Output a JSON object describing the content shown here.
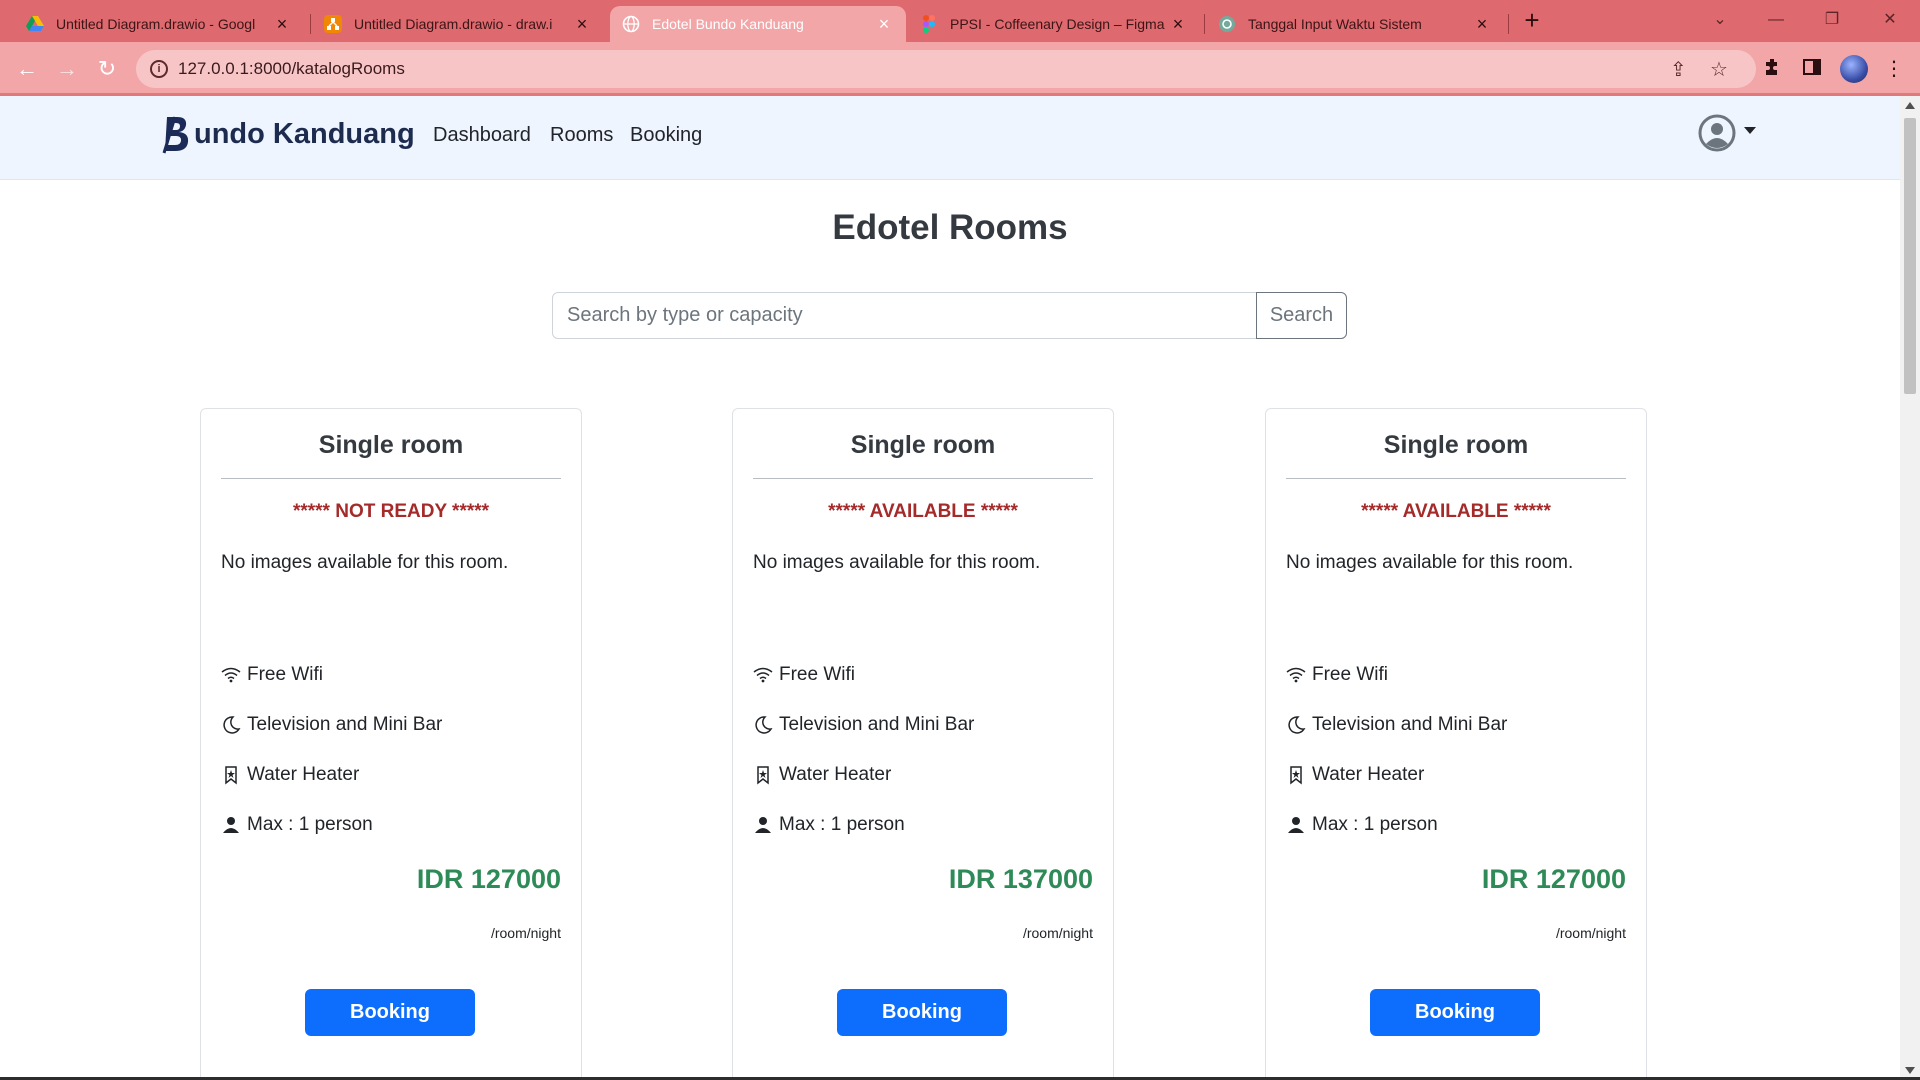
{
  "browser": {
    "tabs": [
      {
        "title": "Untitled Diagram.drawio - Googl",
        "icon": "google-drive-icon"
      },
      {
        "title": "Untitled Diagram.drawio - draw.i",
        "icon": "drawio-icon"
      },
      {
        "title": "Edotel Bundo Kanduang",
        "icon": "globe-icon"
      },
      {
        "title": "PPSI - Coffeenary Design – Figma",
        "icon": "figma-icon"
      },
      {
        "title": "Tanggal Input Waktu Sistem",
        "icon": "chatgpt-icon"
      }
    ],
    "url": "127.0.0.1:8000/katalogRooms",
    "colors": {
      "tabbar": "#de6a6f",
      "toolbar": "#f2a6a8"
    }
  },
  "site": {
    "brand": "undo Kanduang",
    "nav": [
      "Dashboard",
      "Rooms",
      "Booking"
    ]
  },
  "main": {
    "title": "Edotel Rooms",
    "search_placeholder": "Search by type or capacity",
    "search_button": "Search"
  },
  "rooms": [
    {
      "name": "Single room",
      "status": "***** NOT READY *****",
      "no_images": "No images available for this room.",
      "features": [
        {
          "icon": "wifi-icon",
          "label": "Free Wifi"
        },
        {
          "icon": "moon-icon",
          "label": "Television and Mini Bar"
        },
        {
          "icon": "bookmark-icon",
          "label": "Water Heater"
        },
        {
          "icon": "person-icon",
          "label": "Max : 1 person"
        }
      ],
      "price": "IDR 127000",
      "unit": "/room/night",
      "button": "Booking"
    },
    {
      "name": "Single room",
      "status": "***** AVAILABLE *****",
      "no_images": "No images available for this room.",
      "features": [
        {
          "icon": "wifi-icon",
          "label": "Free Wifi"
        },
        {
          "icon": "moon-icon",
          "label": "Television and Mini Bar"
        },
        {
          "icon": "bookmark-icon",
          "label": "Water Heater"
        },
        {
          "icon": "person-icon",
          "label": "Max : 1 person"
        }
      ],
      "price": "IDR 137000",
      "unit": "/room/night",
      "button": "Booking"
    },
    {
      "name": "Single room",
      "status": "***** AVAILABLE *****",
      "no_images": "No images available for this room.",
      "features": [
        {
          "icon": "wifi-icon",
          "label": "Free Wifi"
        },
        {
          "icon": "moon-icon",
          "label": "Television and Mini Bar"
        },
        {
          "icon": "bookmark-icon",
          "label": "Water Heater"
        },
        {
          "icon": "person-icon",
          "label": "Max : 1 person"
        }
      ],
      "price": "IDR 127000",
      "unit": "/room/night",
      "button": "Booking"
    }
  ],
  "colors": {
    "status": "#a52a2a",
    "price": "#2e8b57",
    "primary": "#0d6efd",
    "nav_bg": "#eef5ff"
  }
}
